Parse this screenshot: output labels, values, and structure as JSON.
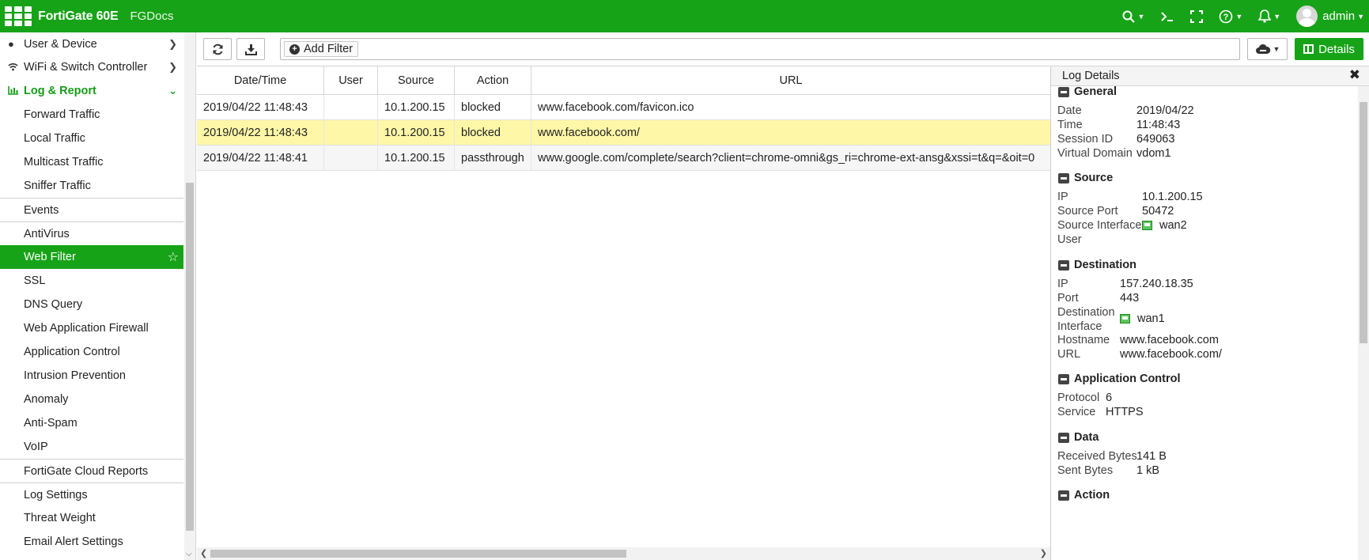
{
  "header": {
    "product": "FortiGate 60E",
    "hostname": "FGDocs",
    "user": "admin",
    "brand_color": "#17a318"
  },
  "sidebar": {
    "items": [
      {
        "label": "User & Device",
        "icon": "user-icon",
        "type": "top"
      },
      {
        "label": "WiFi & Switch Controller",
        "icon": "wifi-icon",
        "type": "top"
      },
      {
        "label": "Log & Report",
        "icon": "bar-chart-icon",
        "type": "section"
      },
      {
        "label": "Forward Traffic",
        "type": "sub"
      },
      {
        "label": "Local Traffic",
        "type": "sub"
      },
      {
        "label": "Multicast Traffic",
        "type": "sub"
      },
      {
        "label": "Sniffer Traffic",
        "type": "sub"
      },
      {
        "label": "Events",
        "type": "sub"
      },
      {
        "label": "AntiVirus",
        "type": "sub"
      },
      {
        "label": "Web Filter",
        "type": "sub",
        "active": true
      },
      {
        "label": "SSL",
        "type": "sub"
      },
      {
        "label": "DNS Query",
        "type": "sub"
      },
      {
        "label": "Web Application Firewall",
        "type": "sub"
      },
      {
        "label": "Application Control",
        "type": "sub"
      },
      {
        "label": "Intrusion Prevention",
        "type": "sub"
      },
      {
        "label": "Anomaly",
        "type": "sub"
      },
      {
        "label": "Anti-Spam",
        "type": "sub"
      },
      {
        "label": "VoIP",
        "type": "sub"
      },
      {
        "label": "FortiGate Cloud Reports",
        "type": "sub"
      },
      {
        "label": "Log Settings",
        "type": "sub"
      },
      {
        "label": "Threat Weight",
        "type": "sub"
      },
      {
        "label": "Email Alert Settings",
        "type": "sub"
      }
    ]
  },
  "toolbar": {
    "add_filter_label": "Add Filter",
    "details_label": "Details"
  },
  "table": {
    "columns": [
      "Date/Time",
      "User",
      "Source",
      "Action",
      "URL"
    ],
    "rows": [
      {
        "datetime": "2019/04/22 11:48:43",
        "user": "",
        "source": "10.1.200.15",
        "action": "blocked",
        "url": "www.facebook.com/favicon.ico"
      },
      {
        "datetime": "2019/04/22 11:48:43",
        "user": "",
        "source": "10.1.200.15",
        "action": "blocked",
        "url": "www.facebook.com/",
        "selected": true
      },
      {
        "datetime": "2019/04/22 11:48:41",
        "user": "",
        "source": "10.1.200.15",
        "action": "passthrough",
        "url": "www.google.com/complete/search?client=chrome-omni&gs_ri=chrome-ext-ansg&xssi=t&q=&oit=0"
      }
    ]
  },
  "details": {
    "title": "Log Details",
    "general": {
      "heading": "General",
      "date_label": "Date",
      "date": "2019/04/22",
      "time_label": "Time",
      "time": "11:48:43",
      "session_label": "Session ID",
      "session": "649063",
      "vdom_label": "Virtual Domain",
      "vdom": "vdom1"
    },
    "source": {
      "heading": "Source",
      "ip_label": "IP",
      "ip": "10.1.200.15",
      "port_label": "Source Port",
      "port": "50472",
      "iface_label": "Source Interface",
      "iface": "wan2",
      "user_label": "User"
    },
    "destination": {
      "heading": "Destination",
      "ip_label": "IP",
      "ip": "157.240.18.35",
      "port_label": "Port",
      "port": "443",
      "iface_label_1": "Destination",
      "iface_label_2": "Interface",
      "iface": "wan1",
      "host_label": "Hostname",
      "host": "www.facebook.com",
      "url_label": "URL",
      "url": "www.facebook.com/"
    },
    "appctrl": {
      "heading": "Application Control",
      "proto_label": "Protocol",
      "proto": "6",
      "service_label": "Service",
      "service": "HTTPS"
    },
    "data": {
      "heading": "Data",
      "recv_label": "Received Bytes",
      "recv": "141 B",
      "sent_label": "Sent Bytes",
      "sent": "1 kB"
    },
    "action": {
      "heading": "Action"
    }
  }
}
